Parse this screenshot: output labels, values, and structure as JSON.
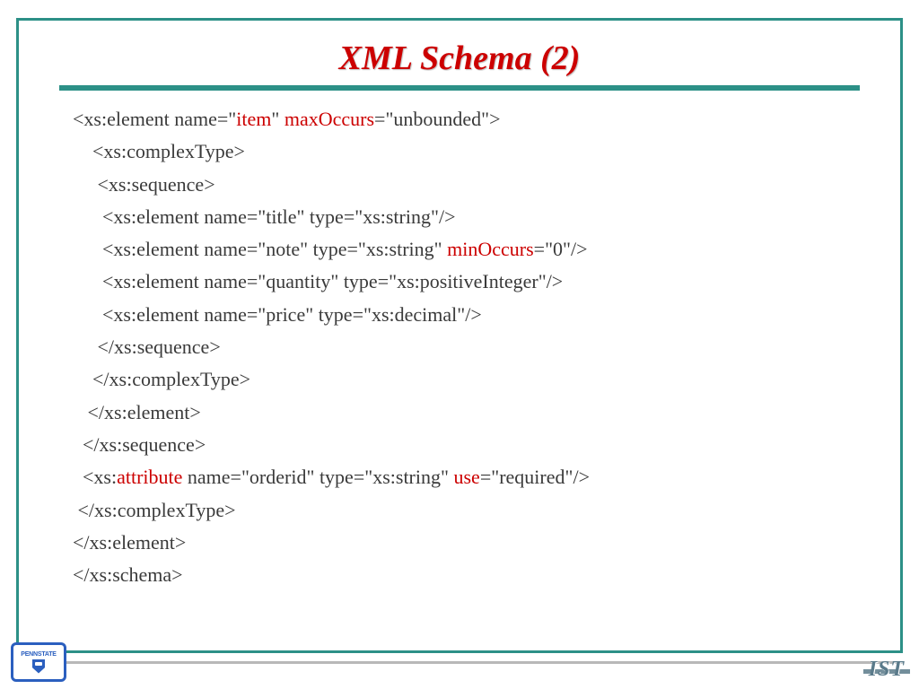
{
  "title": "XML Schema (2)",
  "code": {
    "line1a": "<xs:element name=\"",
    "line1b": "item",
    "line1c": "\" ",
    "line1d": "maxOccurs",
    "line1e": "=\"unbounded\">",
    "line2": "    <xs:complexType>",
    "line3": "     <xs:sequence>",
    "line4": "      <xs:element name=\"title\" type=\"xs:string\"/>",
    "line5a": "      <xs:element name=\"note\" type=\"xs:string\" ",
    "line5b": "minOccurs",
    "line5c": "=\"0\"/>",
    "line6": "      <xs:element name=\"quantity\" type=\"xs:positiveInteger\"/>",
    "line7": "      <xs:element name=\"price\" type=\"xs:decimal\"/>",
    "line8": "     </xs:sequence>",
    "line9": "    </xs:complexType>",
    "line10": "   </xs:element>",
    "line11": "  </xs:sequence>",
    "line12a": "  <xs:",
    "line12b": "attribute",
    "line12c": " name=\"orderid\" type=\"xs:string\" ",
    "line12d": "use",
    "line12e": "=\"required\"/>",
    "line13": " </xs:complexType>",
    "line14": "</xs:element>",
    "line15": "</xs:schema>"
  },
  "footer": {
    "pennstate": "PENNSTATE",
    "ist": "IST"
  }
}
